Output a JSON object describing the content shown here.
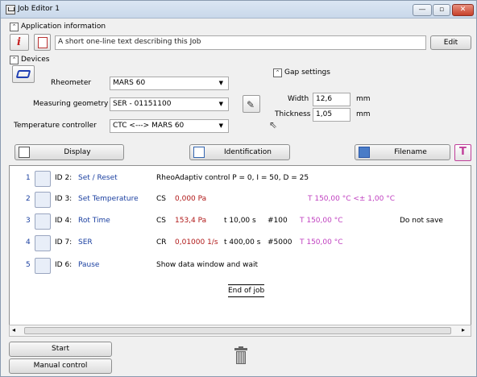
{
  "window": {
    "title": "Job Editor 1",
    "controls": [
      "—",
      "▫",
      "✕"
    ]
  },
  "app_info": {
    "label": "Application information",
    "description": "A short one-line text describing this Job",
    "edit": "Edit"
  },
  "devices": {
    "label": "Devices",
    "rheometer_label": "Rheometer",
    "rheometer": "MARS 60",
    "geometry_label": "Measuring geometry",
    "geometry": "SER - 01151100",
    "temp_label": "Temperature controller",
    "temp": "CTC <---> MARS 60"
  },
  "gap": {
    "label": "Gap settings",
    "width_label": "Width",
    "width": "12,6",
    "width_unit": "mm",
    "thickness_label": "Thickness",
    "thickness": "1,05",
    "thickness_unit": "mm"
  },
  "toolbar": {
    "display": "Display",
    "identification": "Identification",
    "filename": "Filename"
  },
  "rows": [
    {
      "num": "1",
      "id": "ID 2:",
      "name": "Set / Reset",
      "c1": "RheoAdaptiv control P = 0, I = 50, D = 25",
      "icon": "set-reset-icon"
    },
    {
      "num": "2",
      "id": "ID 3:",
      "name": "Set Temperature",
      "mode": "CS",
      "val": "0,000 Pa",
      "temp": "T 150,00 °C <± 1,00 °C",
      "icon": "thermometer-icon"
    },
    {
      "num": "3",
      "id": "ID 4:",
      "name": "Rot Time",
      "mode": "CS",
      "val": "153,4 Pa",
      "time": "t 10,00 s",
      "count": "#100",
      "temp": "T 150,00 °C",
      "extra": "Do not save",
      "icon": "rot-time-icon"
    },
    {
      "num": "4",
      "id": "ID 7:",
      "name": "SER",
      "mode": "CR",
      "val": "0,01000 1/s",
      "time": "t 400,00 s",
      "count": "#5000",
      "temp": "T 150,00 °C",
      "icon": "ser-icon"
    },
    {
      "num": "5",
      "id": "ID 6:",
      "name": "Pause",
      "c1": "Show data window and wait",
      "icon": "pause-icon"
    }
  ],
  "end_of_job": "End of job",
  "bottom": {
    "start": "Start",
    "manual": "Manual control"
  }
}
